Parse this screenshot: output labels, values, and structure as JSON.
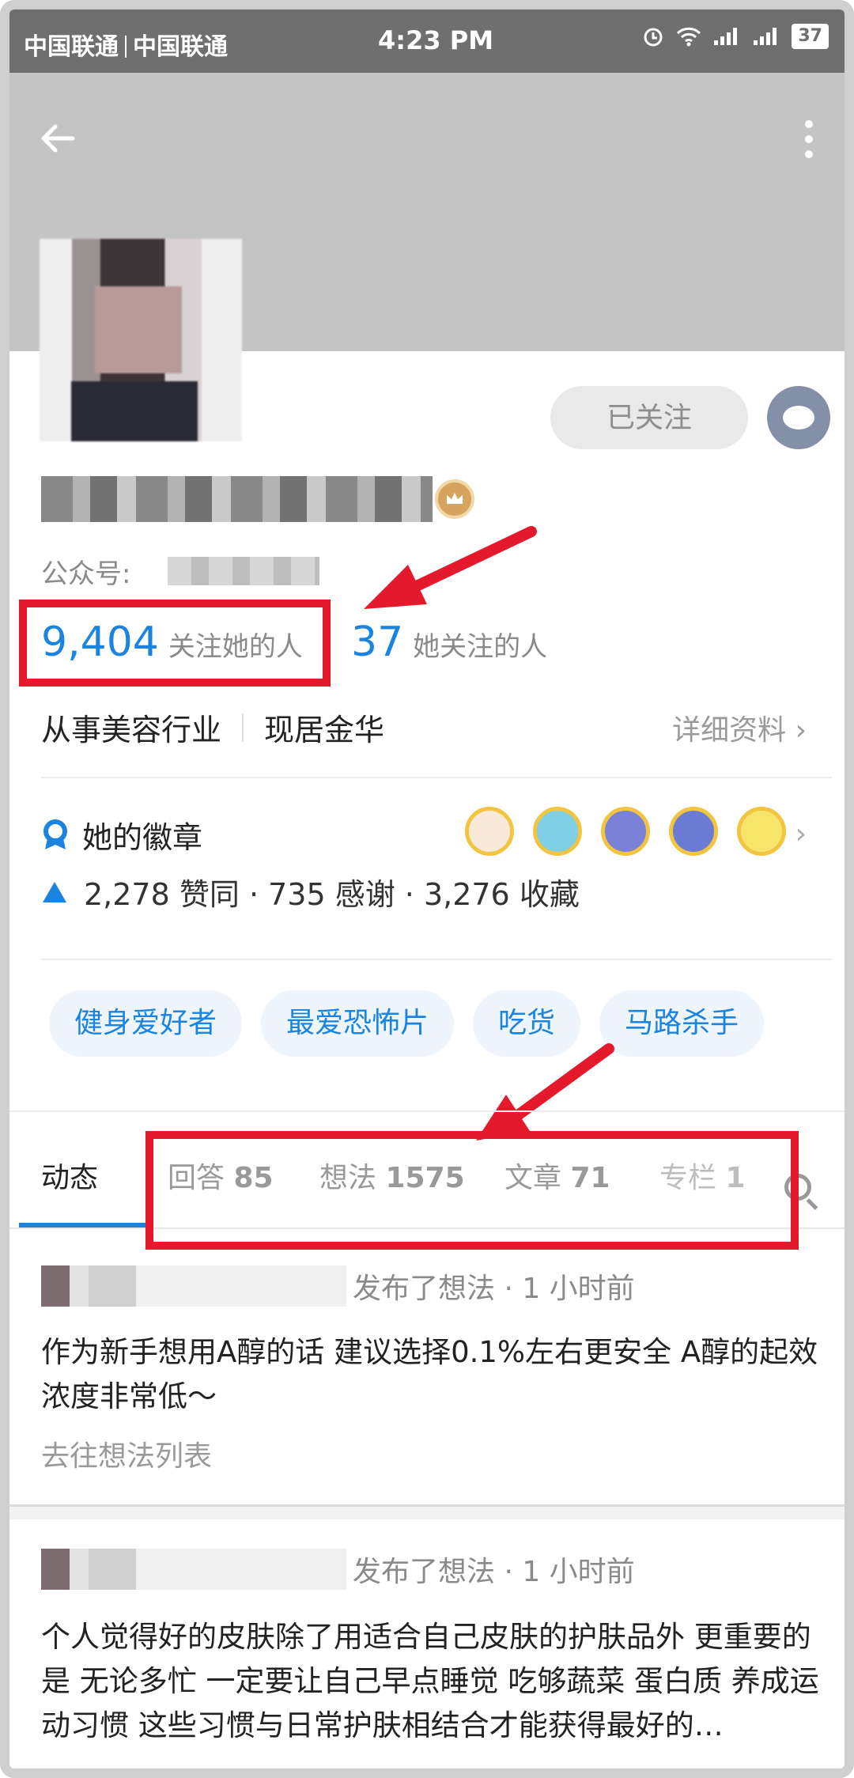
{
  "status_bar": {
    "carrier1": "中国联通",
    "carrier2": "中国联通",
    "time": "4:23 PM",
    "battery": "37"
  },
  "header": {
    "back_icon": "back-arrow-icon",
    "more_icon": "more-vertical-icon"
  },
  "profile": {
    "followed_label": "已关注",
    "gzh_label": "公众号:",
    "followers_count": "9,404",
    "followers_label": "关注她的人",
    "following_count": "37",
    "following_label": "她关注的人",
    "industry": "从事美容行业",
    "location": "现居金华",
    "detail_label": "详细资料",
    "badges_title": "她的徽章",
    "stats_line": "2,278 赞同 · 735 感谢 · 3,276 收藏"
  },
  "tags": [
    "健身爱好者",
    "最爱恐怖片",
    "吃货",
    "马路杀手"
  ],
  "tabs": [
    {
      "label": "动态",
      "count": ""
    },
    {
      "label": "回答",
      "count": "85"
    },
    {
      "label": "想法",
      "count": "1575"
    },
    {
      "label": "文章",
      "count": "71"
    },
    {
      "label": "专栏",
      "count": "1"
    }
  ],
  "feed": [
    {
      "meta": "发布了想法 · 1 小时前",
      "text": "作为新手想用A醇的话 建议选择0.1%左右更安全 A醇的起效浓度非常低～",
      "link": "去往想法列表"
    },
    {
      "meta": "发布了想法 · 1 小时前",
      "text": "个人觉得好的皮肤除了用适合自己皮肤的护肤品外 更重要的是 无论多忙 一定要让自己早点睡觉 吃够蔬菜 蛋白质 养成运动习惯 这些习惯与日常护肤相结合才能获得最好的…"
    }
  ],
  "colors": {
    "accent": "#1a84e0",
    "annotation_red": "#e4192c"
  }
}
